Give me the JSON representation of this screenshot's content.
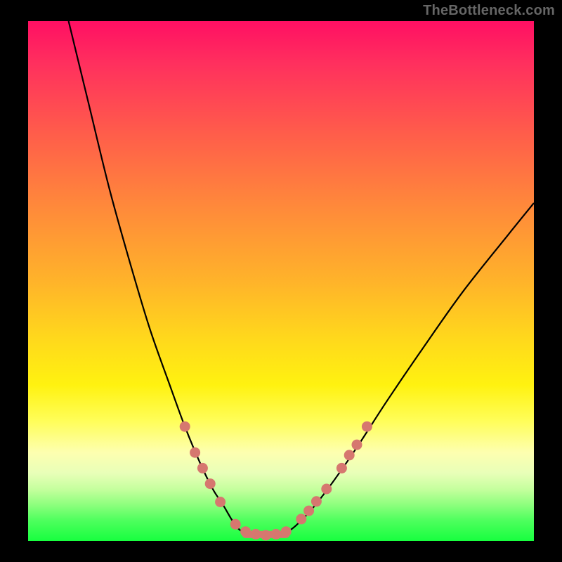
{
  "watermark": "TheBottleneck.com",
  "chart_data": {
    "type": "line",
    "title": "",
    "xlabel": "",
    "ylabel": "",
    "xlim": [
      0,
      100
    ],
    "ylim": [
      0,
      100
    ],
    "series": [
      {
        "name": "curve-left",
        "x": [
          8,
          12,
          16,
          20,
          24,
          28,
          31,
          34,
          36.5,
          38.5,
          40,
          41,
          42,
          43
        ],
        "y": [
          100,
          84,
          68,
          54,
          41,
          30,
          22,
          15,
          10,
          7,
          4.5,
          3,
          2,
          1.5
        ]
      },
      {
        "name": "curve-base",
        "x": [
          43,
          45,
          47,
          49,
          51
        ],
        "y": [
          1.5,
          1.2,
          1.1,
          1.2,
          1.5
        ]
      },
      {
        "name": "curve-right",
        "x": [
          51,
          53,
          56,
          60,
          65,
          71,
          78,
          86,
          95,
          100
        ],
        "y": [
          1.5,
          3,
          6,
          11,
          18,
          27,
          37,
          48,
          59,
          65
        ]
      }
    ],
    "markers": {
      "name": "bottleneck-markers",
      "color": "#d6776f",
      "points": [
        {
          "x": 31,
          "y": 22
        },
        {
          "x": 33,
          "y": 17
        },
        {
          "x": 34.5,
          "y": 14
        },
        {
          "x": 36,
          "y": 11
        },
        {
          "x": 38,
          "y": 7.5
        },
        {
          "x": 41,
          "y": 3.2
        },
        {
          "x": 43,
          "y": 1.8
        },
        {
          "x": 45,
          "y": 1.3
        },
        {
          "x": 47,
          "y": 1.1
        },
        {
          "x": 49,
          "y": 1.3
        },
        {
          "x": 51,
          "y": 1.8
        },
        {
          "x": 54,
          "y": 4.2
        },
        {
          "x": 55.5,
          "y": 5.8
        },
        {
          "x": 57,
          "y": 7.6
        },
        {
          "x": 59,
          "y": 10
        },
        {
          "x": 62,
          "y": 14
        },
        {
          "x": 63.5,
          "y": 16.5
        },
        {
          "x": 65,
          "y": 18.5
        },
        {
          "x": 67,
          "y": 22
        }
      ]
    },
    "bottleneck_zone": {
      "from_x": 43,
      "to_x": 51,
      "color": "#d6776f"
    }
  }
}
